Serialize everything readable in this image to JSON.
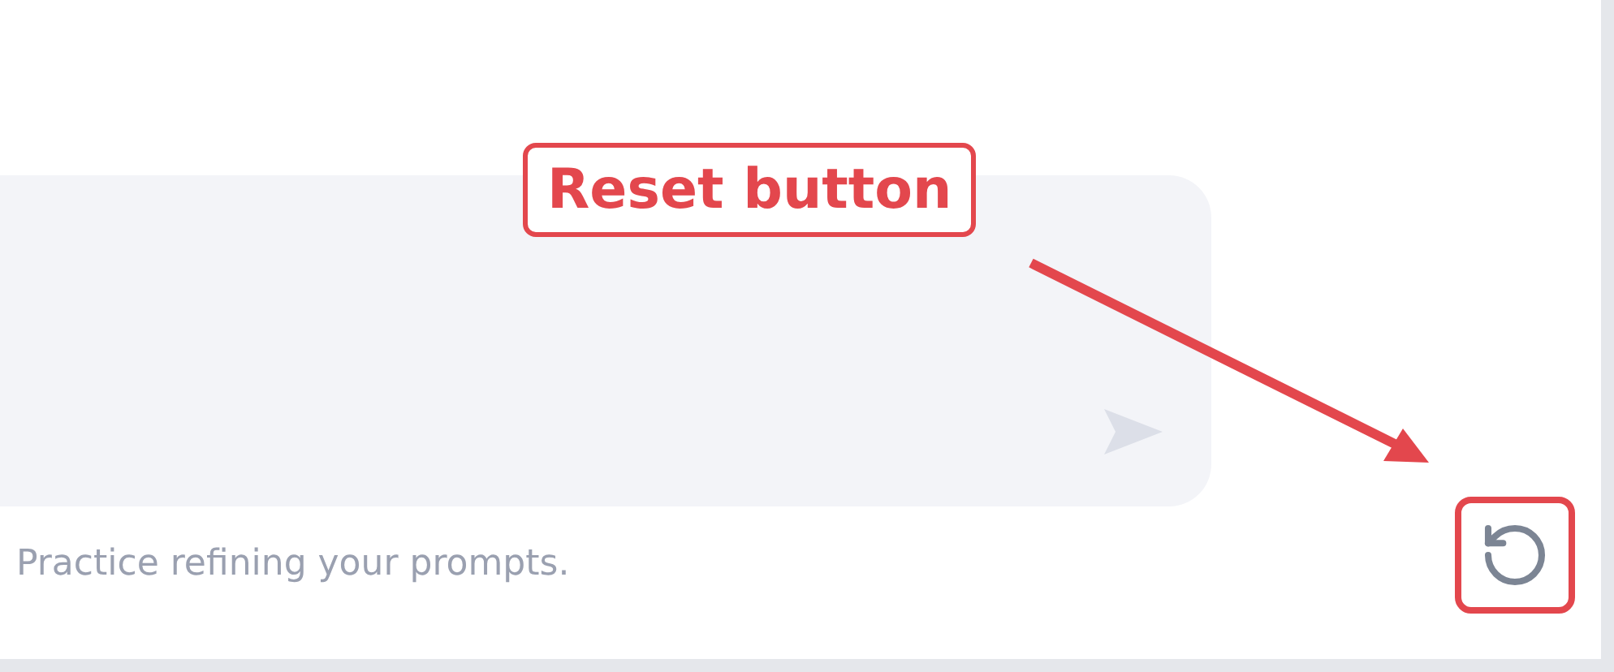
{
  "prompt_box": {
    "send_disabled": true
  },
  "footer_text": "Practice refining your prompts.",
  "reset_button": {
    "highlighted": true
  },
  "annotation": {
    "label": "Reset button"
  }
}
